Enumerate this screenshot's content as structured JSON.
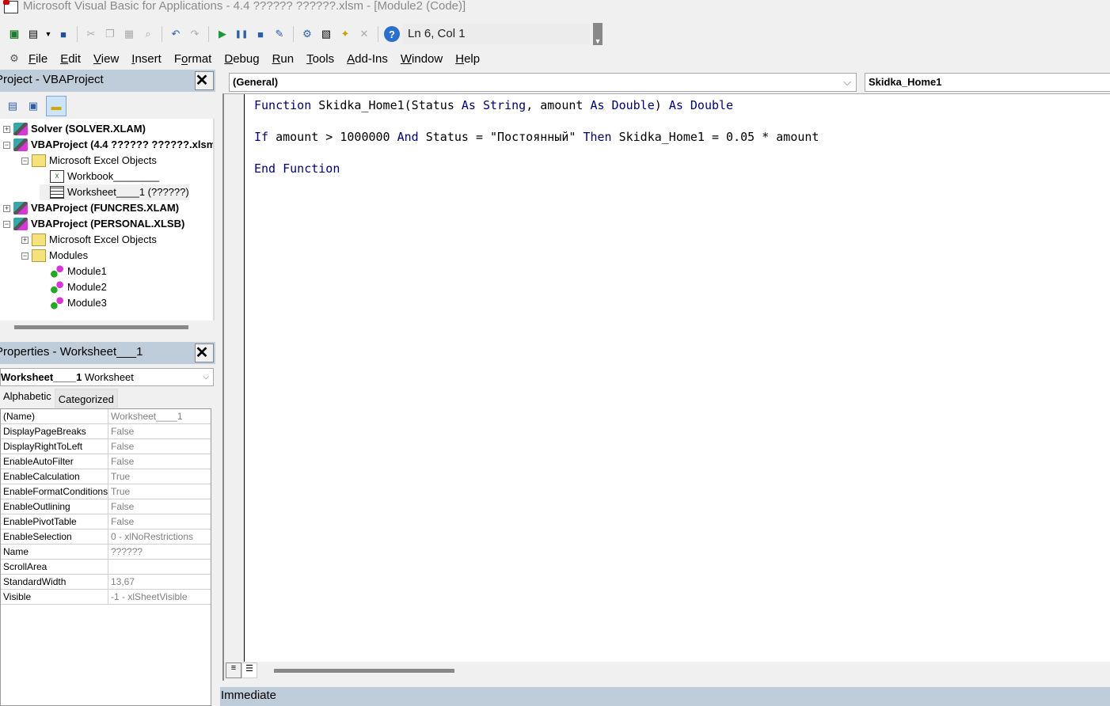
{
  "window": {
    "title": "Microsoft Visual Basic for Applications - 4.4 ?????? ??????.xlsm - [Module2 (Code)]"
  },
  "toolbar": {
    "position": "Ln 6, Col 1",
    "icons": [
      "excel-icon",
      "insert-userform-icon",
      "save-icon",
      "cut-icon",
      "copy-icon",
      "paste-icon",
      "find-icon",
      "undo-icon",
      "redo-icon",
      "run-icon",
      "break-icon",
      "reset-icon",
      "design-mode-icon",
      "project-explorer-icon",
      "properties-icon",
      "object-browser-icon",
      "toolbox-icon",
      "help-icon"
    ]
  },
  "menu": [
    {
      "label": "File",
      "key": "F",
      "rest": "ile"
    },
    {
      "label": "Edit",
      "key": "E",
      "rest": "dit"
    },
    {
      "label": "View",
      "key": "V",
      "rest": "iew"
    },
    {
      "label": "Insert",
      "key": "I",
      "rest": "nsert"
    },
    {
      "label": "Format",
      "key": "F",
      "rest": "o",
      "after": "rmat",
      "pre": "F"
    },
    {
      "label": "Debug",
      "key": "D",
      "rest": "ebug"
    },
    {
      "label": "Run",
      "key": "R",
      "rest": "un"
    },
    {
      "label": "Tools",
      "key": "T",
      "rest": "ools"
    },
    {
      "label": "Add-Ins",
      "key": "A",
      "rest": "dd-Ins"
    },
    {
      "label": "Window",
      "key": "W",
      "rest": "indow"
    },
    {
      "label": "Help",
      "key": "H",
      "rest": "elp"
    }
  ],
  "project": {
    "title": "Project - VBAProject",
    "tree": [
      {
        "label": "Solver (SOLVER.XLAM)",
        "level": 0,
        "icon": "project",
        "bold": true,
        "expander": "+"
      },
      {
        "label": "VBAProject (4.4 ?????? ??????.xlsm)",
        "level": 0,
        "icon": "project",
        "bold": true,
        "expander": "-"
      },
      {
        "label": "Microsoft Excel Objects",
        "level": 1,
        "icon": "folder",
        "expander": "-"
      },
      {
        "label": "Workbook________",
        "level": 2,
        "icon": "workbook"
      },
      {
        "label": "Worksheet____1 (??????)",
        "level": 2,
        "icon": "worksheet",
        "selected": true
      },
      {
        "label": "VBAProject (FUNCRES.XLAM)",
        "level": 0,
        "icon": "project",
        "bold": true,
        "expander": "+"
      },
      {
        "label": "VBAProject (PERSONAL.XLSB)",
        "level": 0,
        "icon": "project",
        "bold": true,
        "expander": "-"
      },
      {
        "label": "Microsoft Excel Objects",
        "level": 1,
        "icon": "folder",
        "expander": "+"
      },
      {
        "label": "Modules",
        "level": 1,
        "icon": "folder",
        "expander": "-"
      },
      {
        "label": "Module1",
        "level": 2,
        "icon": "module"
      },
      {
        "label": "Module2",
        "level": 2,
        "icon": "module"
      },
      {
        "label": "Module3",
        "level": 2,
        "icon": "module"
      }
    ]
  },
  "properties": {
    "title": "Properties - Worksheet___1",
    "object_name": "Worksheet____1",
    "object_type": "Worksheet",
    "tabs": [
      "Alphabetic",
      "Categorized"
    ],
    "rows": [
      [
        "(Name)",
        "Worksheet____1"
      ],
      [
        "DisplayPageBreaks",
        "False"
      ],
      [
        "DisplayRightToLeft",
        "False"
      ],
      [
        "EnableAutoFilter",
        "False"
      ],
      [
        "EnableCalculation",
        "True"
      ],
      [
        "EnableFormatConditionsCalculation",
        "True"
      ],
      [
        "EnableOutlining",
        "False"
      ],
      [
        "EnablePivotTable",
        "False"
      ],
      [
        "EnableSelection",
        "0 - xlNoRestrictions"
      ],
      [
        "Name",
        "??????"
      ],
      [
        "ScrollArea",
        ""
      ],
      [
        "StandardWidth",
        "13,67"
      ],
      [
        "Visible",
        "-1 - xlSheetVisible"
      ]
    ]
  },
  "code": {
    "object_combo": "(General)",
    "proc_combo": "Skidka_Home1",
    "lines": [
      [
        [
          "kw",
          "Function"
        ],
        [
          "t",
          " Skidka_Home1(Status "
        ],
        [
          "kw",
          "As String"
        ],
        [
          "t",
          ", amount "
        ],
        [
          "kw",
          "As Double"
        ],
        [
          "t",
          ") "
        ],
        [
          "kw",
          "As Double"
        ]
      ],
      [
        [
          "kw",
          "If"
        ],
        [
          "t",
          " amount > 1000000 "
        ],
        [
          "kw",
          "And"
        ],
        [
          "t",
          " Status = \"Постоянный\" "
        ],
        [
          "kw",
          "Then"
        ],
        [
          "t",
          " Skidka_Home1 = 0.05 * amount"
        ]
      ],
      [
        [
          "kw",
          "End Function"
        ]
      ]
    ]
  },
  "immediate": {
    "title": "Immediate"
  }
}
